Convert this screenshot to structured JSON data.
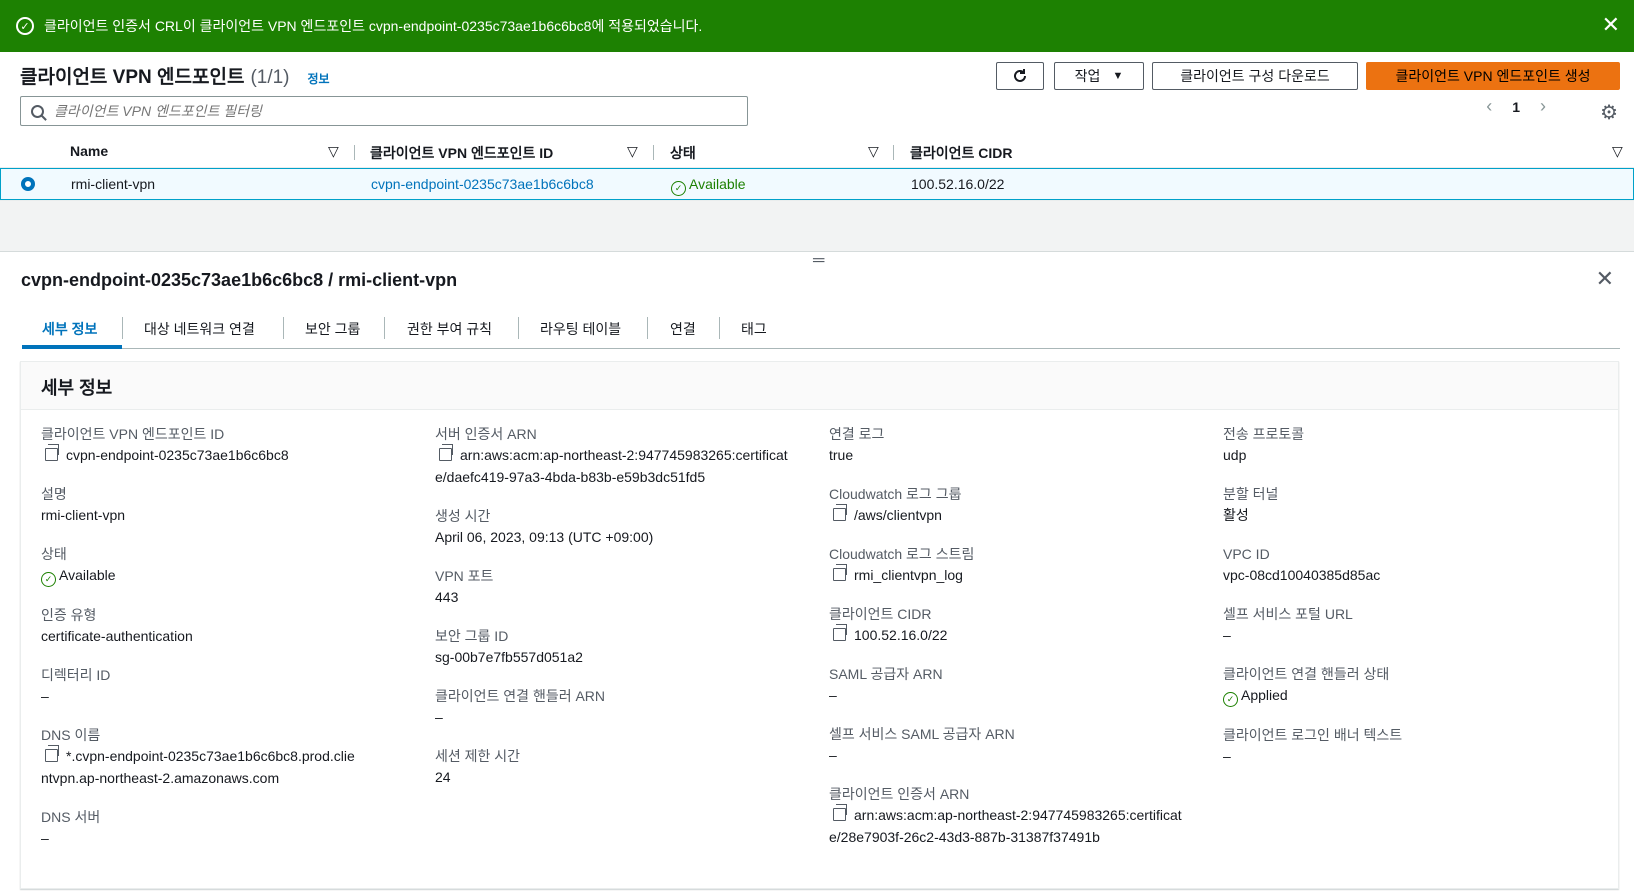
{
  "flash": {
    "message": "클라이언트 인증서 CRL이 클라이언트 VPN 엔드포인트 cvpn-endpoint-0235c73ae1b6c6bc8에 적용되었습니다."
  },
  "header": {
    "title": "클라이언트 VPN 엔드포인트",
    "count": "(1/1)",
    "info": "정보",
    "actions_label": "작업",
    "download_label": "클라이언트 구성 다운로드",
    "create_label": "클라이언트 VPN 엔드포인트 생성"
  },
  "search": {
    "placeholder": "클라이언트 VPN 엔드포인트 필터링"
  },
  "pager": {
    "page": "1"
  },
  "table": {
    "columns": [
      "Name",
      "클라이언트 VPN 엔드포인트 ID",
      "상태",
      "클라이언트 CIDR"
    ],
    "rows": [
      {
        "name": "rmi-client-vpn",
        "id": "cvpn-endpoint-0235c73ae1b6c6bc8",
        "status": "Available",
        "cidr": "100.52.16.0/22"
      }
    ]
  },
  "panel": {
    "title": "cvpn-endpoint-0235c73ae1b6c6bc8 / rmi-client-vpn",
    "tabs": [
      "세부 정보",
      "대상 네트워크 연결",
      "보안 그룹",
      "권한 부여 규칙",
      "라우팅 테이블",
      "연결",
      "태그"
    ],
    "section_title": "세부 정보"
  },
  "details": {
    "col1": {
      "endpoint_id_label": "클라이언트 VPN 엔드포인트 ID",
      "endpoint_id": "cvpn-endpoint-0235c73ae1b6c6bc8",
      "desc_label": "설명",
      "desc": "rmi-client-vpn",
      "state_label": "상태",
      "state": "Available",
      "auth_label": "인증 유형",
      "auth": "certificate-authentication",
      "dir_label": "디렉터리 ID",
      "dir": "–",
      "dns_label": "DNS 이름",
      "dns": "*.cvpn-endpoint-0235c73ae1b6c6bc8.prod.clientvpn.ap-northeast-2.amazonaws.com",
      "dnsserver_label": "DNS 서버",
      "dnsserver": "–"
    },
    "col2": {
      "server_cert_label": "서버 인증서 ARN",
      "server_cert": "arn:aws:acm:ap-northeast-2:947745983265:certificate/daefc419-97a3-4bda-b83b-e59b3dc51fd5",
      "created_label": "생성 시간",
      "created": "April 06, 2023, 09:13 (UTC +09:00)",
      "port_label": "VPN 포트",
      "port": "443",
      "sg_label": "보안 그룹 ID",
      "sg": "sg-00b7e7fb557d051a2",
      "handler_arn_label": "클라이언트 연결 핸들러 ARN",
      "handler_arn": "–",
      "session_label": "세션 제한 시간",
      "session": "24"
    },
    "col3": {
      "connlog_label": "연결 로그",
      "connlog": "true",
      "cwgroup_label": "Cloudwatch 로그 그룹",
      "cwgroup": "/aws/clientvpn",
      "cwstream_label": "Cloudwatch 로그 스트림",
      "cwstream": "rmi_clientvpn_log",
      "cidr_label": "클라이언트 CIDR",
      "cidr": "100.52.16.0/22",
      "saml_label": "SAML 공급자 ARN",
      "saml": "–",
      "selfsaml_label": "셀프 서비스 SAML 공급자 ARN",
      "selfsaml": "–",
      "client_cert_label": "클라이언트 인증서 ARN",
      "client_cert": "arn:aws:acm:ap-northeast-2:947745983265:certificate/28e7903f-26c2-43d3-887b-31387f37491b"
    },
    "col4": {
      "protocol_label": "전송 프로토콜",
      "protocol": "udp",
      "split_label": "분할 터널",
      "split": "활성",
      "vpc_label": "VPC ID",
      "vpc": "vpc-08cd10040385d85ac",
      "portal_label": "셀프 서비스 포털 URL",
      "portal": "–",
      "handler_state_label": "클라이언트 연결 핸들러 상태",
      "handler_state": "Applied",
      "banner_label": "클라이언트 로그인 배너 텍스트",
      "banner": "–"
    }
  },
  "colors": {
    "success": "#1d8102",
    "link": "#0073bb",
    "primary": "#ec7211"
  }
}
